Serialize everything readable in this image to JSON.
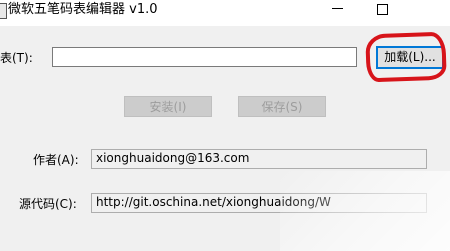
{
  "window": {
    "title": "微软五笔码表编辑器 v1.0",
    "minimize_label": "",
    "maximize_label": ""
  },
  "form": {
    "codetable_label": "码表(T):",
    "codetable_value": "",
    "load_button": "加载(L)...",
    "install_button": "安装(I)",
    "save_button": "保存(S)",
    "author_label": "作者(A):",
    "author_value": "xionghuaidong@163.com",
    "source_label": "源代码(C):",
    "source_value": "http://git.oschina.net/xionghuaidong/W"
  },
  "colors": {
    "annotation": "#d7141a",
    "focus_border": "#0078d7"
  },
  "icons": [
    "app-icon",
    "minimize-icon",
    "maximize-icon"
  ]
}
